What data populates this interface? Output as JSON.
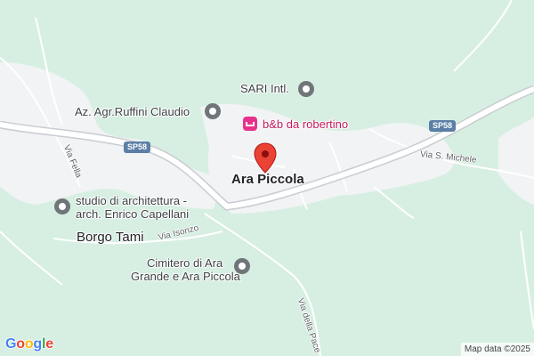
{
  "map": {
    "colors": {
      "land": "#d7efe2",
      "urban": "#f1f3f4",
      "road": "#ffffff",
      "road_outline": "#c9ccd1",
      "shield": "#5b7fa6",
      "pin": "#ea4335",
      "hotel": "#e8318c"
    },
    "town_label": "Ara Piccola",
    "poi": [
      {
        "name": "SARI Intl.",
        "icon": "place-icon"
      },
      {
        "name": "Az. Agr.Ruffini Claudio",
        "icon": "place-icon"
      },
      {
        "name": "b&b da robertino",
        "icon": "hotel-icon"
      },
      {
        "name_lines": [
          "studio di architettura -",
          "arch. Enrico Capellani"
        ],
        "icon": "place-icon"
      },
      {
        "name_lines": [
          "Cimitero di Ara",
          "Grande e Ara Piccola"
        ],
        "icon": "cemetery-icon"
      }
    ],
    "locality": "Borgo Tami",
    "roads": {
      "sp58": "SP58",
      "via_fella": "Via Fella",
      "via_isonzo": "Via Isonzo",
      "via_s_michele": "Via S. Michele",
      "via_della_pace": "Via della Pace"
    },
    "branding": {
      "logo": "Google",
      "attribution": "Map data ©2025"
    }
  }
}
